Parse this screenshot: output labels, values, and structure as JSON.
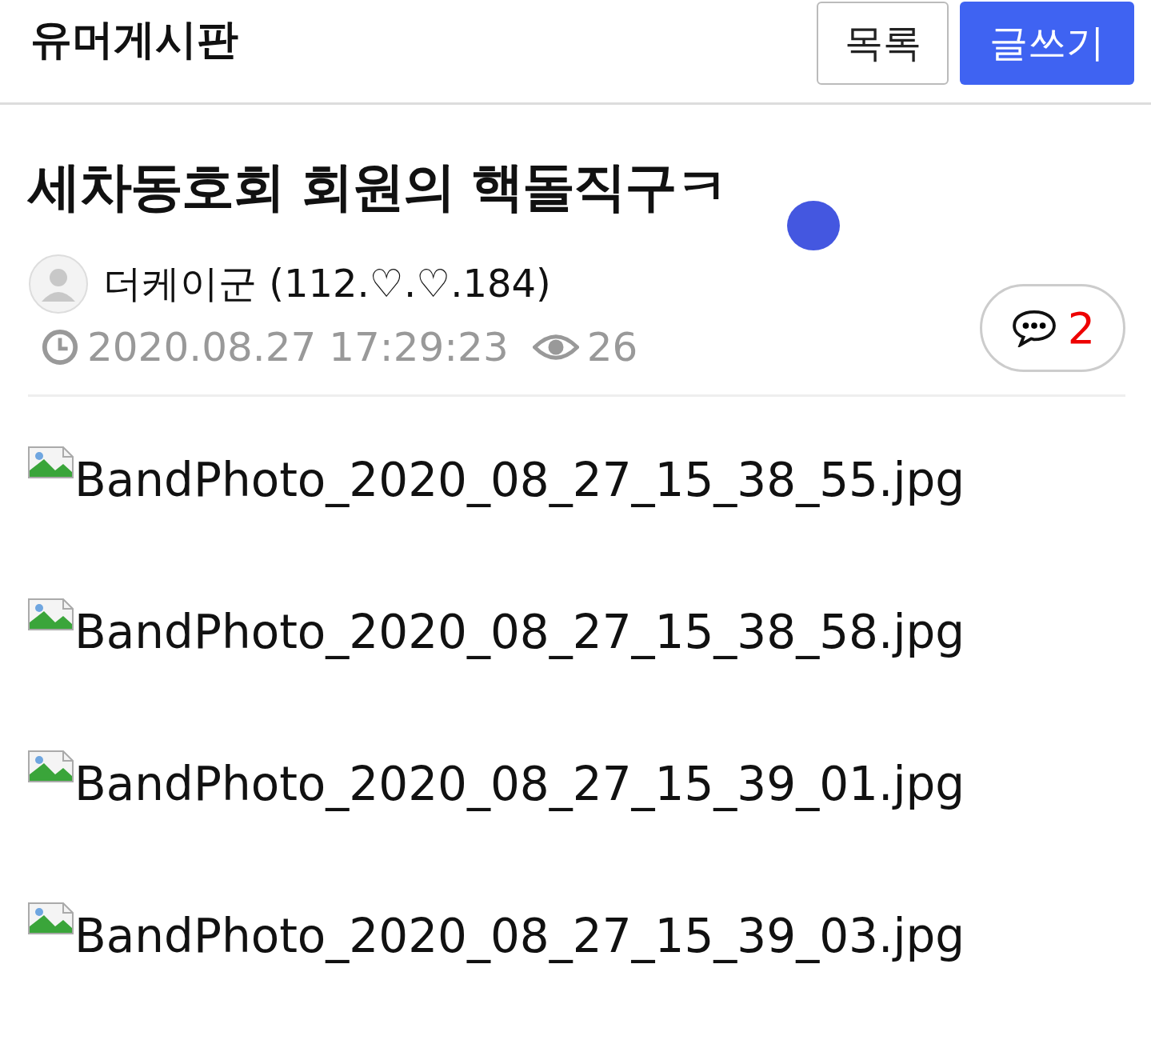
{
  "header": {
    "title": "유머게시판",
    "buttons": [
      {
        "label": "목록",
        "kind": "outline"
      },
      {
        "label": "글쓰기",
        "kind": "primary"
      }
    ]
  },
  "post": {
    "title": "세차동호회 회원의 핵돌직구ㅋ",
    "author": "더케이군 (112.♡.♡.184)",
    "date": "2020.08.27 17:29:23",
    "views": "26",
    "comments": "2"
  },
  "images": [
    {
      "alt": "BandPhoto_2020_08_27_15_38_55.jpg"
    },
    {
      "alt": "BandPhoto_2020_08_27_15_38_58.jpg"
    },
    {
      "alt": "BandPhoto_2020_08_27_15_39_01.jpg"
    },
    {
      "alt": "BandPhoto_2020_08_27_15_39_03.jpg"
    }
  ]
}
